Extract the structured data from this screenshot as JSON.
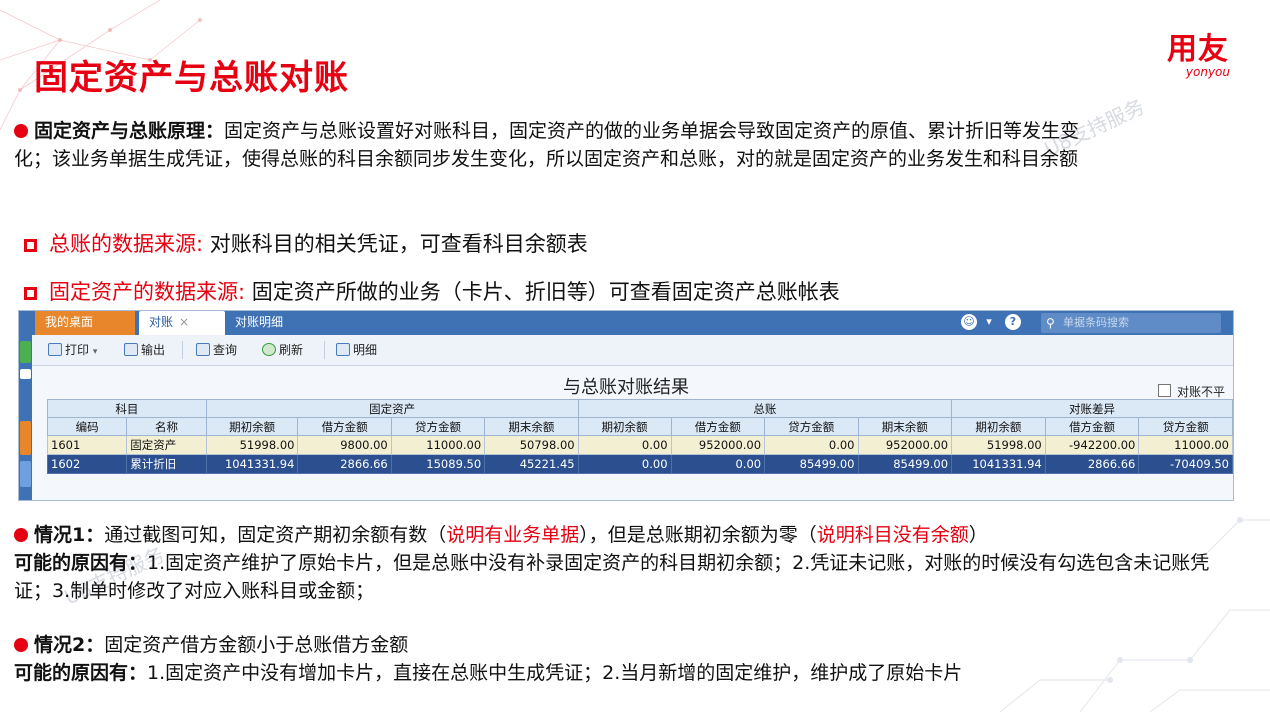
{
  "slide": {
    "title": "固定资产与总账对账",
    "logo_main": "用友",
    "logo_sub": "yonyou",
    "watermark": "U8支持服务",
    "principle_label": "固定资产与总账原理：",
    "principle_text": "固定资产与总账设置好对账科目，固定资产的做的业务单据会导致固定资产的原值、累计折旧等发生变化；该业务单据生成凭证，使得总账的科目余额同步发生变化，所以固定资产和总账，对的就是固定资产的业务发生和科目余额",
    "src1_label": "总账的数据来源:",
    "src1_text": "对账科目的相关凭证，可查看科目余额表",
    "src2_label": "固定资产的数据来源:",
    "src2_text": "固定资产所做的业务（卡片、折旧等）可查看固定资产总账帐表",
    "case1_label": "情况1：",
    "case1_text_a": "通过截图可知，固定资产期初余额有数（",
    "case1_red_a": "说明有业务单据",
    "case1_text_b": "），但是总账期初余额为零（",
    "case1_red_b": "说明科目没有余额",
    "case1_text_c": "）",
    "reason_label": "可能的原因有：",
    "reason1_text": "1.固定资产维护了原始卡片，但是总账中没有补录固定资产的科目期初余额；2.凭证未记账，对账的时候没有勾选包含未记账凭证；3.制单时修改了对应入账科目或金额；",
    "case2_label": "情况2：",
    "case2_text": "固定资产借方金额小于总账借方金额",
    "reason2_text": "1.固定资产中没有增加卡片，直接在总账中生成凭证；2.当月新增的固定维护，维护成了原始卡片"
  },
  "app": {
    "tabs": [
      "我的桌面",
      "对账",
      "对账明细"
    ],
    "tab_close": "×",
    "search_placeholder": "单据条码搜索",
    "toolbar": {
      "print": "打印",
      "export": "输出",
      "query": "查询",
      "refresh": "刷新",
      "detail": "明细"
    },
    "report_title": "与总账对账结果",
    "imbalance_label": "对账不平",
    "group_headers": [
      "科目",
      "固定资产",
      "总账",
      "对账差异"
    ],
    "col_headers": [
      "编码",
      "名称",
      "期初余额",
      "借方金额",
      "贷方金额",
      "期末余额",
      "期初余额",
      "借方金额",
      "贷方金额",
      "期末余额",
      "期初余额",
      "借方金额",
      "贷方金额"
    ],
    "rows": [
      [
        "1601",
        "固定资产",
        "51998.00",
        "9800.00",
        "11000.00",
        "50798.00",
        "0.00",
        "952000.00",
        "0.00",
        "952000.00",
        "51998.00",
        "-942200.00",
        "11000.00"
      ],
      [
        "1602",
        "累计折旧",
        "1041331.94",
        "2866.66",
        "15089.50",
        "45221.45",
        "0.00",
        "0.00",
        "85499.00",
        "85499.00",
        "1041331.94",
        "2866.66",
        "-70409.50"
      ]
    ],
    "colors": {
      "accent": "#e60012",
      "tab_bar": "#3f72b5",
      "home_tab": "#e8862c",
      "selected_row": "#2b4f8f"
    }
  }
}
